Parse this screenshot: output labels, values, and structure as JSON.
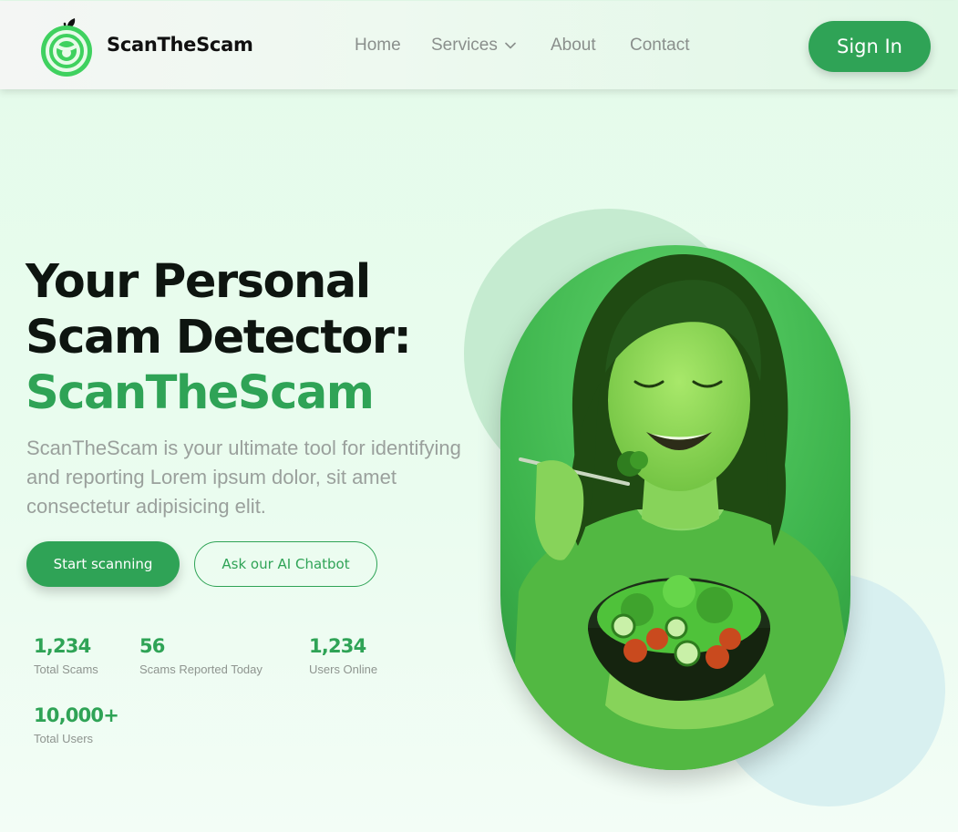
{
  "header": {
    "brand": "ScanTheScam",
    "nav": [
      {
        "label": "Home"
      },
      {
        "label": "Services",
        "icon": "chevron-down-icon"
      },
      {
        "label": "About"
      },
      {
        "label": "Contact"
      }
    ],
    "sign_in": "Sign In",
    "logo_icon": "apple-logo-icon"
  },
  "hero": {
    "headline_line1": "Your Personal",
    "headline_line2": "Scam Detector:",
    "headline_accent": "ScanTheScam",
    "description": "ScanTheScam is your ultimate tool for identifying and reporting Lorem ipsum dolor, sit amet consectetur adipisicing elit.",
    "primary_button": "Start scanning",
    "secondary_button": "Ask our AI Chatbot",
    "image": "woman-eating-salad-photo"
  },
  "stats": [
    {
      "value": "1,234",
      "label": "Total Scams"
    },
    {
      "value": "56",
      "label": "Scams Reported Today"
    },
    {
      "value": "1,234",
      "label": "Users Online"
    },
    {
      "value": "10,000+",
      "label": "Total Users"
    }
  ],
  "colors": {
    "accent": "#2fa356",
    "background": "#e4fbea",
    "muted_text": "#9aa09c",
    "decor_green_circle": "#c5ebd0",
    "decor_blue_circle": "#d8f0f0"
  }
}
